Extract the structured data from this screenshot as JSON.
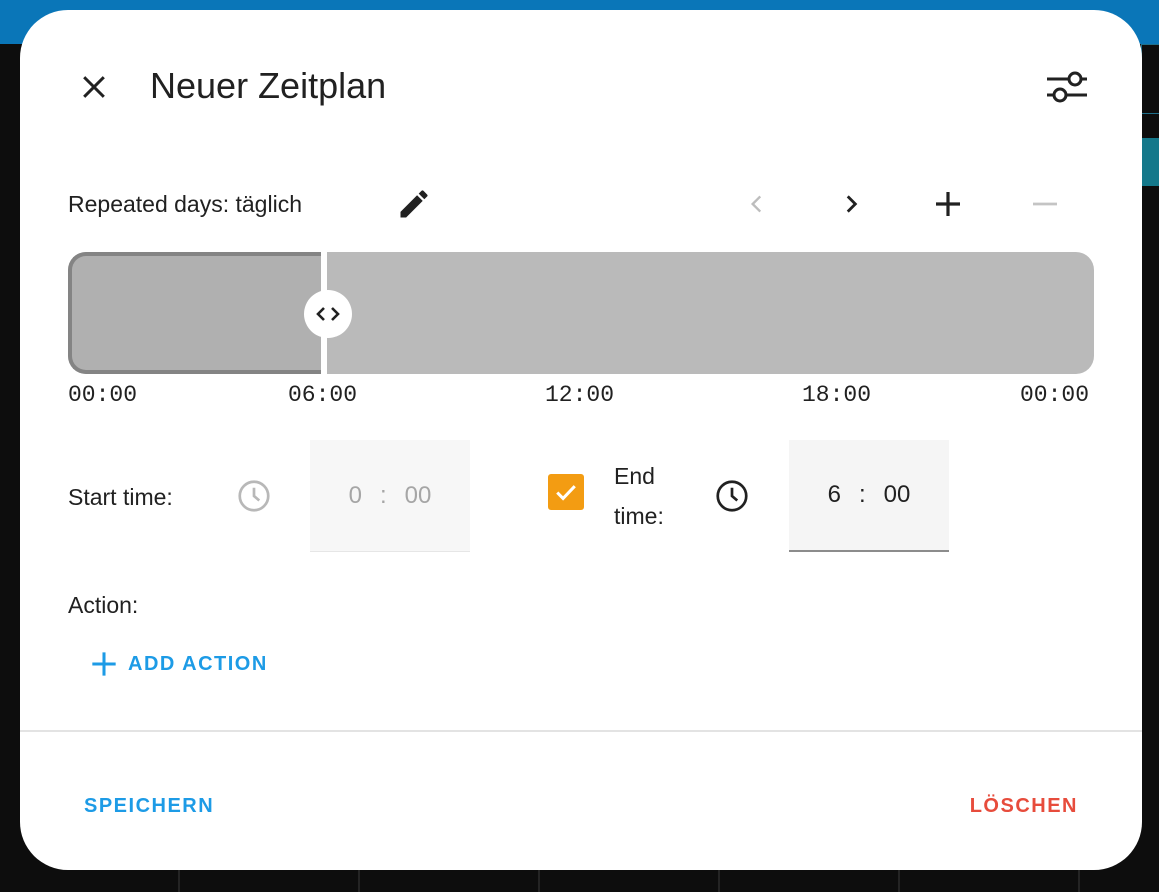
{
  "dialog": {
    "title": "Neuer Zeitplan",
    "close_icon": "close-icon",
    "settings_icon": "tune-icon"
  },
  "days": {
    "label": "Repeated days: täglich",
    "edit_icon": "pencil-icon"
  },
  "timeline_nav": {
    "prev_icon": "chevron-left-icon",
    "next_icon": "chevron-right-icon",
    "add_icon": "plus-icon",
    "remove_icon": "minus-icon"
  },
  "timeline": {
    "ticks": [
      "00:00",
      "06:00",
      "12:00",
      "18:00",
      "00:00"
    ],
    "selected_block": {
      "start": "00:00",
      "end": "06:00"
    },
    "handle_icon": "resize-horizontal-icon"
  },
  "start_time": {
    "label": "Start time:",
    "hours": "0",
    "separator": ":",
    "minutes": "00",
    "disabled": true
  },
  "end_time": {
    "checkbox_checked": true,
    "label": "End time:",
    "hours": "6",
    "separator": ":",
    "minutes": "00"
  },
  "action": {
    "label": "Action:",
    "add_label": "ADD ACTION"
  },
  "footer": {
    "save_label": "SPEICHERN",
    "delete_label": "LÖSCHEN"
  },
  "colors": {
    "accent_blue": "#1d9be6",
    "delete_red": "#e74c3c",
    "checkbox_orange": "#f39c12"
  }
}
